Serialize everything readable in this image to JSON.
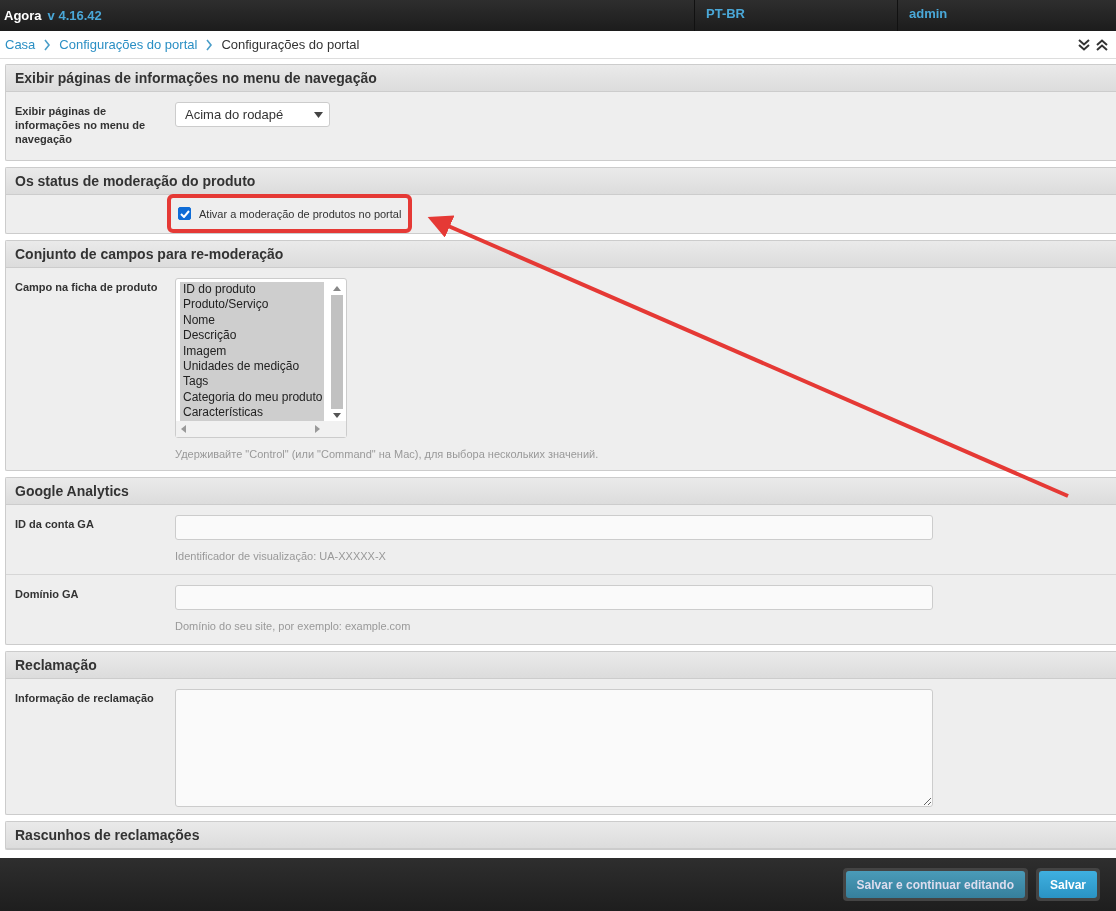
{
  "top_bar": {
    "brand": "Agora",
    "version": "v 4.16.42",
    "language": "PT-BR",
    "user": "admin"
  },
  "breadcrumb": [
    {
      "label": "Casa",
      "link": true
    },
    {
      "label": "Configurações do portal",
      "link": true
    },
    {
      "label": "Configurações do portal",
      "link": false
    }
  ],
  "sections": [
    {
      "title": "Exibir páginas de informações no menu de navegação",
      "rows": [
        {
          "kind": "select",
          "label": "Exibir páginas de informações no menu de navegação",
          "value": "Acima do rodapé"
        }
      ]
    },
    {
      "title": "Os status de moderação do produto",
      "rows": [
        {
          "kind": "checkbox",
          "label": "Ativar a moderação de produtos no portal",
          "checked": true
        }
      ]
    },
    {
      "title": "Conjunto de campos para re-moderação",
      "rows": [
        {
          "kind": "listbox",
          "label": "Campo na ficha de produto",
          "options": [
            {
              "label": "ID do produto",
              "selected": true
            },
            {
              "label": "Produto/Serviço",
              "selected": true
            },
            {
              "label": "Nome",
              "selected": true
            },
            {
              "label": "Descrição",
              "selected": true
            },
            {
              "label": "Imagem",
              "selected": true
            },
            {
              "label": "Unidades de medição",
              "selected": true
            },
            {
              "label": "Tags",
              "selected": true
            },
            {
              "label": "Categoria do meu produto",
              "selected": true
            },
            {
              "label": "Características",
              "selected": true
            }
          ],
          "help": "Удерживайте \"Control\" (или \"Command\" на Mac), для выбора нескольких значений."
        }
      ]
    },
    {
      "title": "Google Analytics",
      "rows": [
        {
          "kind": "text",
          "label": "ID da conta GA",
          "help": "Identificador de visualização: UA-XXXXX-X"
        },
        {
          "kind": "text",
          "label": "Domínio GA",
          "help": "Domínio do seu site, por exemplo: example.com"
        }
      ]
    },
    {
      "title": "Reclamação",
      "rows": [
        {
          "kind": "textarea",
          "label": "Informação de reclamação"
        }
      ]
    },
    {
      "title": "Rascunhos de reclamações"
    }
  ],
  "buttons": [
    {
      "label": "Salvar e continuar editando",
      "kind": "secondary"
    },
    {
      "label": "Salvar",
      "kind": "primary"
    }
  ]
}
